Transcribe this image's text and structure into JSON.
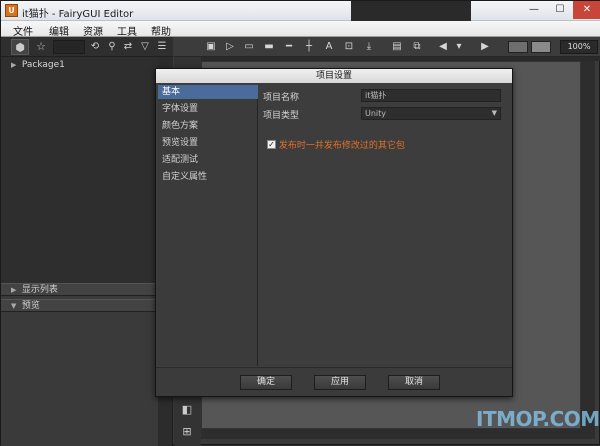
{
  "window": {
    "title": "it猫扑 - FairyGUI Editor",
    "icon_text": "U"
  },
  "window_controls": {
    "minimize": "—",
    "maximize": "☐",
    "close": "✕"
  },
  "menu": [
    "文件",
    "编辑",
    "资源",
    "工具",
    "帮助"
  ],
  "library": {
    "tree": [
      {
        "label": "Package1",
        "arrow": "▶"
      }
    ],
    "sections": [
      {
        "label": "显示列表",
        "arrow": "▶"
      },
      {
        "label": "预览",
        "arrow": "▼"
      }
    ]
  },
  "toolbar": {
    "zoom": "100%"
  },
  "dialog": {
    "title": "项目设置",
    "nav": [
      "基本",
      "字体设置",
      "颜色方案",
      "预览设置",
      "适配测试",
      "自定义属性"
    ],
    "selected_nav": "基本",
    "fields": {
      "project_name_label": "项目名称",
      "project_name_value": "it猫扑",
      "project_type_label": "项目类型",
      "project_type_value": "Unity"
    },
    "checkbox": {
      "label": "发布时一并发布修改过的其它包",
      "checked": true
    },
    "buttons": {
      "ok": "确定",
      "apply": "应用",
      "cancel": "取消"
    }
  },
  "watermark": "ITMOP.COM",
  "colors": {
    "accent": "#4a6c9b",
    "checkbox_label": "#e0702a",
    "close": "#c8453a"
  }
}
